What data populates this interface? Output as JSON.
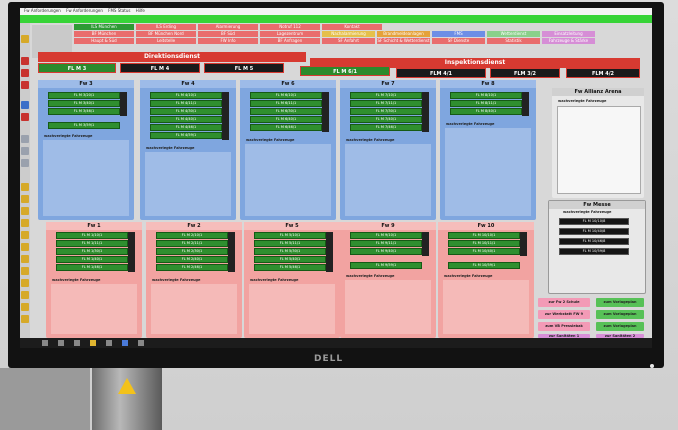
{
  "monitor": {
    "brand": "DELL"
  },
  "menubar": {
    "items": [
      "Fw Anforderungen",
      "Fw Anforderungen",
      "FMS Status",
      "Hilfe"
    ]
  },
  "nav_tabs": {
    "row1": [
      {
        "label": "ILS München",
        "color": "#2e9a34"
      },
      {
        "label": "ILS Erding",
        "color": "#e96d6d"
      },
      {
        "label": "Alarmierung",
        "color": "#e96d6d"
      },
      {
        "label": "Notruf 112",
        "color": "#e96d6d"
      },
      {
        "label": "Kontakt",
        "color": "#e96d6d"
      }
    ],
    "row2": [
      {
        "label": "BF München",
        "color": "#e96d6d"
      },
      {
        "label": "BF München Nord",
        "color": "#e96d6d"
      },
      {
        "label": "BF Süd",
        "color": "#e96d6d"
      },
      {
        "label": "Lagezentrum",
        "color": "#e96d6d"
      },
      {
        "label": "Nachalarmierung",
        "color": "#e5c04a"
      },
      {
        "label": "Brandmeldeanlagen",
        "color": "#e5a23a"
      },
      {
        "label": "FMS",
        "color": "#6d8ee6"
      },
      {
        "label": "Wetterdienst",
        "color": "#8ad08a"
      },
      {
        "label": "Einsatzleitung",
        "color": "#d68ed6"
      }
    ],
    "row3": [
      {
        "label": "Haupt & Süd",
        "color": "#e96d6d"
      },
      {
        "label": "Leitstelle",
        "color": "#e96d6d"
      },
      {
        "label": "FW Info",
        "color": "#e96d6d"
      },
      {
        "label": "BF Anfragen",
        "color": "#e96d6d"
      },
      {
        "label": "SF Anfahrt",
        "color": "#e96d6d"
      },
      {
        "label": "SF Schicht & Wetterdienst",
        "color": "#e96d6d"
      },
      {
        "label": "SF Dienste",
        "color": "#e96d6d"
      },
      {
        "label": "Statistik",
        "color": "#e96d6d"
      },
      {
        "label": "Fahrzeuge & Stärke",
        "color": "#d68ed6"
      }
    ]
  },
  "sections": {
    "direktion": "Direktionsdienst",
    "inspektion": "Inspektionsdienst"
  },
  "status_boxes": [
    "FL M 3",
    "FL M 4",
    "FL M 5",
    "FL M 6/1",
    "FLM 4/1",
    "FLM 3/2",
    "FLM 4/2"
  ],
  "stations_top": [
    {
      "name": "Fw 3",
      "vehicles": [
        "FL M 3/20/1",
        "FL M 3/40/1",
        "FL M 3/46/1"
      ],
      "extra": "FL M 3/59/1",
      "note": "wachverlegte Fahrzeuge"
    },
    {
      "name": "Fw 4",
      "vehicles": [
        "FL M 4/10/1",
        "FL M 4/11/1",
        "FL M 4/30/1",
        "FL M 4/40/1",
        "FL M 4/46/1",
        "FL M 4/59/1"
      ],
      "note": "wachverlegte Fahrzeuge"
    },
    {
      "name": "Fw 6",
      "vehicles": [
        "FL M 6/10/1",
        "FL M 6/11/1",
        "FL M 6/30/1",
        "FL M 6/40/1",
        "FL M 6/46/1"
      ],
      "note": "wachverlegte Fahrzeuge"
    },
    {
      "name": "Fw 7",
      "vehicles": [
        "FL M 7/10/1",
        "FL M 7/11/1",
        "FL M 7/30/1",
        "FL M 7/40/1",
        "FL M 7/46/1"
      ],
      "note": "wachverlegte Fahrzeuge"
    },
    {
      "name": "Fw 8",
      "vehicles": [
        "FL M 8/10/1",
        "FL M 8/11/1",
        "FL M 8/40/1"
      ],
      "note": "wachverlegte Fahrzeuge"
    }
  ],
  "stations_bottom": [
    {
      "name": "Fw 1",
      "vehicles": [
        "FL M 1/10/1",
        "FL M 1/11/1",
        "FL M 1/30/1",
        "FL M 1/40/1",
        "FL M 1/46/1"
      ],
      "note": "wachverlegte Fahrzeuge"
    },
    {
      "name": "Fw 2",
      "vehicles": [
        "FL M 2/10/1",
        "FL M 2/11/1",
        "FL M 2/30/1",
        "FL M 2/40/1",
        "FL M 2/46/1"
      ],
      "note": "wachverlegte Fahrzeuge"
    },
    {
      "name": "Fw 5",
      "vehicles": [
        "FL M 5/10/1",
        "FL M 5/11/1",
        "FL M 5/30/1",
        "FL M 5/40/1",
        "FL M 5/46/1"
      ],
      "note": "wachverlegte Fahrzeuge"
    },
    {
      "name": "Fw 9",
      "vehicles": [
        "FL M 9/10/1",
        "FL M 9/11/1",
        "FL M 9/40/1"
      ],
      "extra": "FL M 9/59/1",
      "note": "wachverlegte Fahrzeuge"
    },
    {
      "name": "Fw 10",
      "vehicles": [
        "FL M 10/10/1",
        "FL M 10/11/1",
        "FL M 10/40/1"
      ],
      "extra": "FL M 10/59/1",
      "note": "wachverlegte Fahrzeuge"
    }
  ],
  "allianz": {
    "name": "Fw Allianz Arena",
    "note": "wachverlegte Fahrzeuge"
  },
  "messe": {
    "name": "Fw Messe",
    "note": "wachverlegte Fahrzeuge",
    "vehicles": [
      "FL M 10/10/8",
      "FL M 10/40/8",
      "FL M 10/46/8",
      "FL M 10/59/8"
    ]
  },
  "bottom_buttons": [
    {
      "label": "zur Fw 2 Schule",
      "color": "pink"
    },
    {
      "label": "zum Vorlageplan",
      "color": "green"
    },
    {
      "label": "zur Werkstatt FW 9",
      "color": "pink"
    },
    {
      "label": "zum Vorlageplan",
      "color": "green"
    },
    {
      "label": "zum VB Pressiebak",
      "color": "pink"
    },
    {
      "label": "zum Vorlageplan",
      "color": "green"
    },
    {
      "label": "zur Sanitäten 1",
      "color": "purple"
    },
    {
      "label": "zur Sanitäten 2",
      "color": "purple"
    }
  ]
}
